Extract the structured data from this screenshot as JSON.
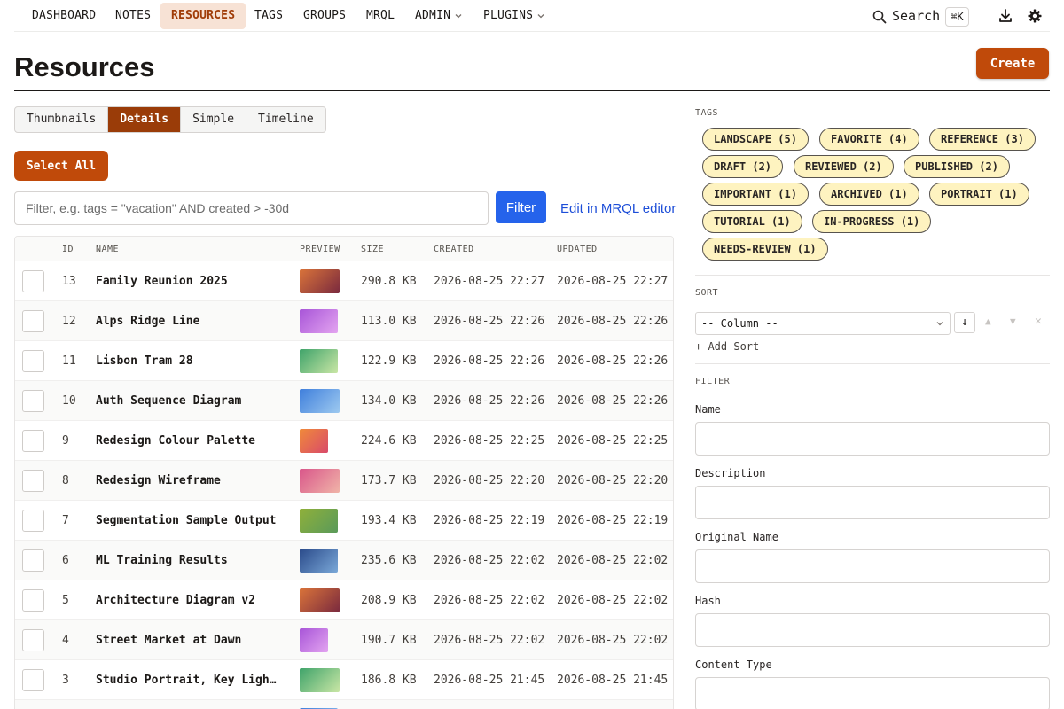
{
  "nav": {
    "items": [
      {
        "label": "DASHBOARD",
        "active": false,
        "dropdown": false
      },
      {
        "label": "NOTES",
        "active": false,
        "dropdown": false
      },
      {
        "label": "RESOURCES",
        "active": true,
        "dropdown": false
      },
      {
        "label": "TAGS",
        "active": false,
        "dropdown": false
      },
      {
        "label": "GROUPS",
        "active": false,
        "dropdown": false
      },
      {
        "label": "MRQL",
        "active": false,
        "dropdown": false
      },
      {
        "label": "ADMIN",
        "active": false,
        "dropdown": true
      },
      {
        "label": "PLUGINS",
        "active": false,
        "dropdown": true
      }
    ],
    "search_label": "Search",
    "search_shortcut": "⌘K",
    "download_icon": "download-icon",
    "settings_icon": "gear-icon"
  },
  "page": {
    "title": "Resources",
    "create_label": "Create"
  },
  "view_tabs": [
    "Thumbnails",
    "Details",
    "Simple",
    "Timeline"
  ],
  "active_view": "Details",
  "select_all_label": "Select All",
  "filter": {
    "placeholder": "Filter, e.g. tags = \"vacation\" AND created > -30d",
    "button_label": "Filter",
    "mrql_link": "Edit in MRQL editor"
  },
  "table": {
    "headers": [
      "ID",
      "NAME",
      "PREVIEW",
      "SIZE",
      "CREATED",
      "UPDATED"
    ],
    "rows": [
      {
        "id": "13",
        "name": "Family Reunion 2025",
        "size": "290.8 KB",
        "created": "2026-08-25 22:27",
        "updated": "2026-08-25 22:27",
        "preview": "copper-gradient"
      },
      {
        "id": "12",
        "name": "Alps Ridge Line",
        "size": "113.0 KB",
        "created": "2026-08-25 22:26",
        "updated": "2026-08-25 22:26",
        "preview": "violet-gradient"
      },
      {
        "id": "11",
        "name": "Lisbon Tram 28",
        "size": "122.9 KB",
        "created": "2026-08-25 22:26",
        "updated": "2026-08-25 22:26",
        "preview": "green-gradient"
      },
      {
        "id": "10",
        "name": "Auth Sequence Diagram",
        "size": "134.0 KB",
        "created": "2026-08-25 22:26",
        "updated": "2026-08-25 22:26",
        "preview": "blue-gradient"
      },
      {
        "id": "9",
        "name": "Redesign Colour Palette",
        "size": "224.6 KB",
        "created": "2026-08-25 22:25",
        "updated": "2026-08-25 22:25",
        "preview": "orange-gradient"
      },
      {
        "id": "8",
        "name": "Redesign Wireframe",
        "size": "173.7 KB",
        "created": "2026-08-25 22:20",
        "updated": "2026-08-25 22:20",
        "preview": "pink-gradient"
      },
      {
        "id": "7",
        "name": "Segmentation Sample Output",
        "size": "193.4 KB",
        "created": "2026-08-25 22:19",
        "updated": "2026-08-25 22:19",
        "preview": "olive-gradient"
      },
      {
        "id": "6",
        "name": "ML Training Results",
        "size": "235.6 KB",
        "created": "2026-08-25 22:02",
        "updated": "2026-08-25 22:02",
        "preview": "navy-gradient"
      },
      {
        "id": "5",
        "name": "Architecture Diagram v2",
        "size": "208.9 KB",
        "created": "2026-08-25 22:02",
        "updated": "2026-08-25 22:02",
        "preview": "copper-gradient"
      },
      {
        "id": "4",
        "name": "Street Market at Dawn",
        "size": "190.7 KB",
        "created": "2026-08-25 22:02",
        "updated": "2026-08-25 22:02",
        "preview": "violet-gradient"
      },
      {
        "id": "3",
        "name": "Studio Portrait, Key Light …",
        "size": "186.8 KB",
        "created": "2026-08-25 21:45",
        "updated": "2026-08-25 21:45",
        "preview": "green-gradient"
      },
      {
        "id": "",
        "name": "",
        "size": "",
        "created": "",
        "updated": "",
        "preview": "blue-gradient"
      }
    ]
  },
  "sidebar": {
    "tags_heading": "TAGS",
    "tags": [
      "LANDSCAPE (5)",
      "FAVORITE (4)",
      "REFERENCE (3)",
      "DRAFT (2)",
      "REVIEWED (2)",
      "PUBLISHED (2)",
      "IMPORTANT (1)",
      "ARCHIVED (1)",
      "PORTRAIT (1)",
      "TUTORIAL (1)",
      "IN-PROGRESS (1)",
      "NEEDS-REVIEW (1)"
    ],
    "sort_heading": "SORT",
    "sort_column_placeholder": "-- Column --",
    "sort_direction": "↓",
    "move_up": "▲",
    "move_down": "▼",
    "remove": "✕",
    "add_sort": "+ Add Sort",
    "filter_heading": "FILTER",
    "filter_fields": [
      "Name",
      "Description",
      "Original Name",
      "Hash",
      "Content Type"
    ]
  },
  "colors": {
    "accent": "#c04a0a",
    "accent_dark": "#9a3c08",
    "link": "#1d4ed8",
    "filter_button": "#2563eb",
    "tag_fill": "#fef3c0"
  }
}
